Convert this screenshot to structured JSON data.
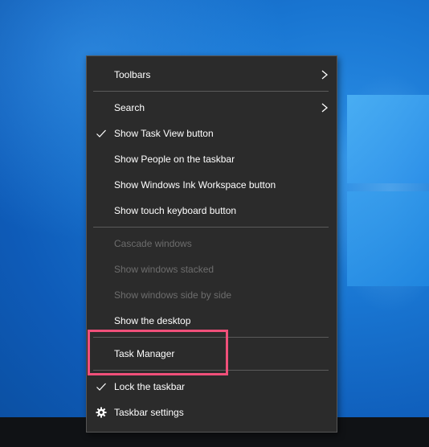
{
  "menu": {
    "items": [
      {
        "label": "Toolbars",
        "submenu": true,
        "checked": false,
        "enabled": true
      },
      {
        "label": "Search",
        "submenu": true,
        "checked": false,
        "enabled": true
      },
      {
        "label": "Show Task View button",
        "submenu": false,
        "checked": true,
        "enabled": true
      },
      {
        "label": "Show People on the taskbar",
        "submenu": false,
        "checked": false,
        "enabled": true
      },
      {
        "label": "Show Windows Ink Workspace button",
        "submenu": false,
        "checked": false,
        "enabled": true
      },
      {
        "label": "Show touch keyboard button",
        "submenu": false,
        "checked": false,
        "enabled": true
      },
      {
        "label": "Cascade windows",
        "submenu": false,
        "checked": false,
        "enabled": false
      },
      {
        "label": "Show windows stacked",
        "submenu": false,
        "checked": false,
        "enabled": false
      },
      {
        "label": "Show windows side by side",
        "submenu": false,
        "checked": false,
        "enabled": false
      },
      {
        "label": "Show the desktop",
        "submenu": false,
        "checked": false,
        "enabled": true
      },
      {
        "label": "Task Manager",
        "submenu": false,
        "checked": false,
        "enabled": true
      },
      {
        "label": "Lock the taskbar",
        "submenu": false,
        "checked": true,
        "enabled": true
      },
      {
        "label": "Taskbar settings",
        "submenu": false,
        "checked": false,
        "enabled": true,
        "icon": "gear-icon"
      }
    ]
  },
  "colors": {
    "menu_bg": "#2b2b2b",
    "text": "#ffffff",
    "disabled_text": "#6d6d6d",
    "highlight": "#f0507a",
    "desktop": "#1976d2",
    "taskbar": "#101215"
  }
}
